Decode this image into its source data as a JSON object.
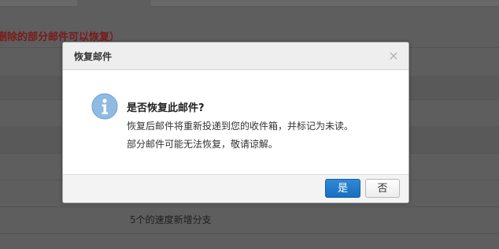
{
  "background": {
    "notice": "删除的部分邮件可以恢复）",
    "row_text": "5个的速度新增分支"
  },
  "dialog": {
    "title": "恢复邮件",
    "close_glyph": "×",
    "icon": "info-icon",
    "heading": "是否恢复此邮件?",
    "line1": "恢复后邮件将重新投递到您的收件箱，并标记为未读。",
    "line2": "部分邮件可能无法恢复，敬请谅解。",
    "yes_label": "是",
    "no_label": "否"
  },
  "colors": {
    "accent": "#1d78c6",
    "info_icon": "#8fbbe3",
    "notice": "#b3231f"
  }
}
